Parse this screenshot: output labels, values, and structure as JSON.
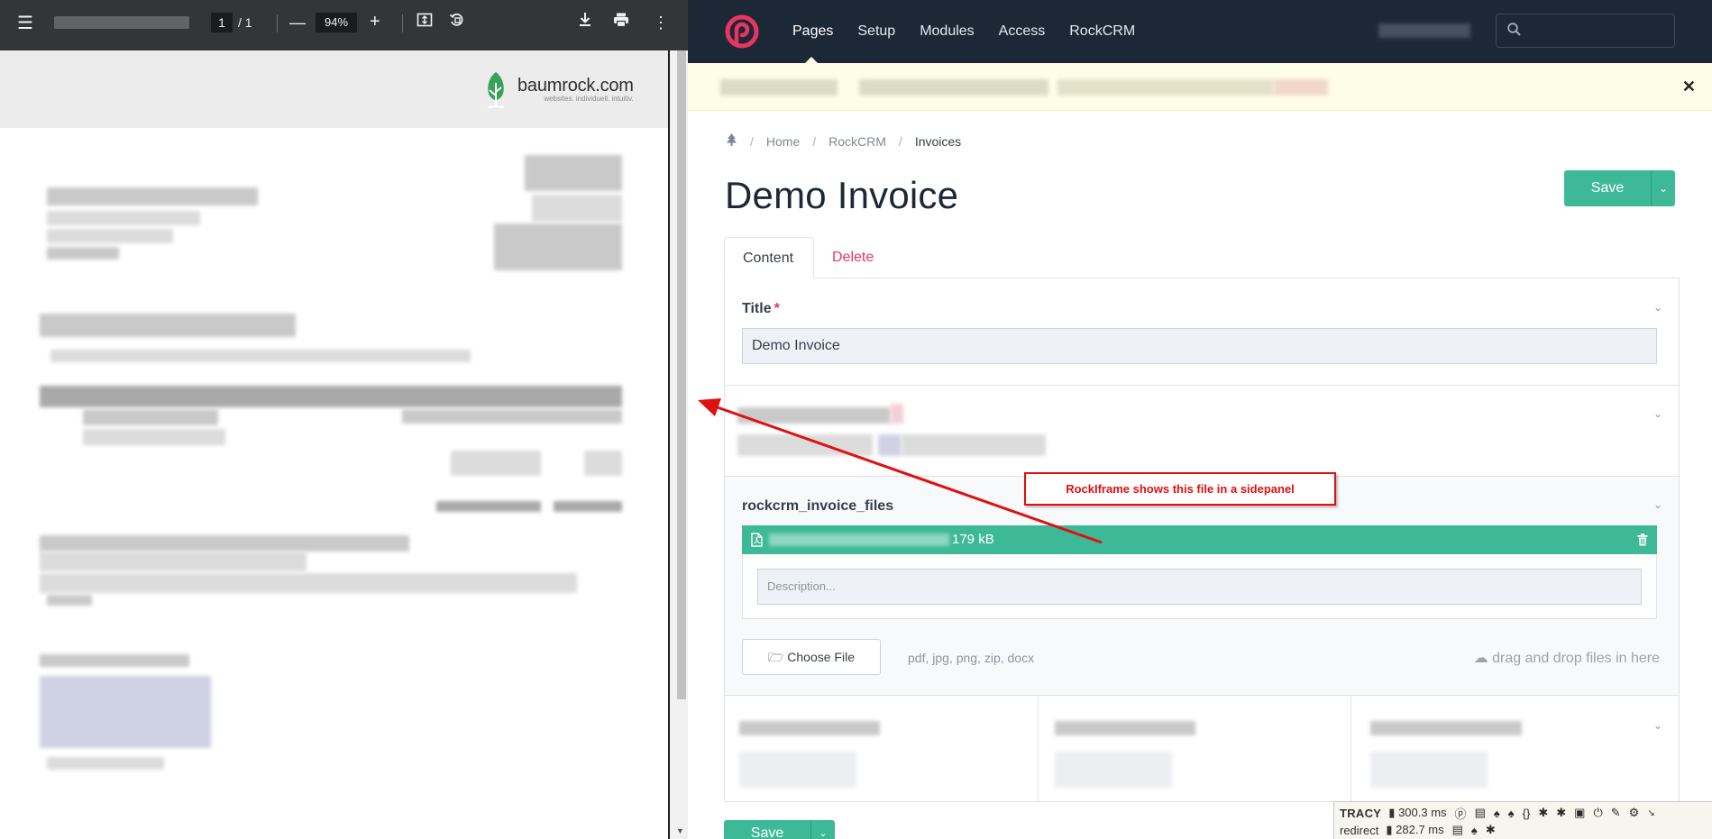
{
  "pdf_viewer": {
    "page_current": "1",
    "page_total": "1",
    "zoom": "94%",
    "brand_name": "baumrock.com",
    "brand_tagline": "websites. individuell. intuitiv.",
    "icons": [
      "menu-icon",
      "zoom-out-icon",
      "zoom-in-icon",
      "fit-page-icon",
      "rotate-icon",
      "download-icon",
      "print-icon",
      "more-icon"
    ]
  },
  "admin": {
    "nav": [
      "Pages",
      "Setup",
      "Modules",
      "Access",
      "RockCRM"
    ],
    "breadcrumb": {
      "home_icon": "tree-icon",
      "items": [
        "Home",
        "RockCRM",
        "Invoices"
      ]
    },
    "page_title": "Demo Invoice",
    "save_label": "Save",
    "tabs": {
      "content": "Content",
      "delete": "Delete"
    },
    "title_field": {
      "label": "Title",
      "required_mark": "*",
      "value": "Demo Invoice"
    },
    "files_field": {
      "label": "rockcrm_invoice_files",
      "file_size": "179 kB",
      "description_placeholder": "Description...",
      "choose_file_label": "Choose File",
      "allowed_extensions": "pdf, jpg, png, zip, docx",
      "drag_drop_text": "drag and drop files in here"
    },
    "colors": {
      "topbar": "#1c2836",
      "accent": "#3eb998",
      "danger": "#e83561",
      "notice_bg": "#fefde8"
    }
  },
  "tracy": {
    "label": "TRACY",
    "redirect_label": "redirect",
    "time_main": "300.3 ms",
    "time_redirect": "282.7 ms"
  },
  "annotation": {
    "text": "RockIframe shows this file in a sidepanel",
    "color": "#e01010"
  }
}
